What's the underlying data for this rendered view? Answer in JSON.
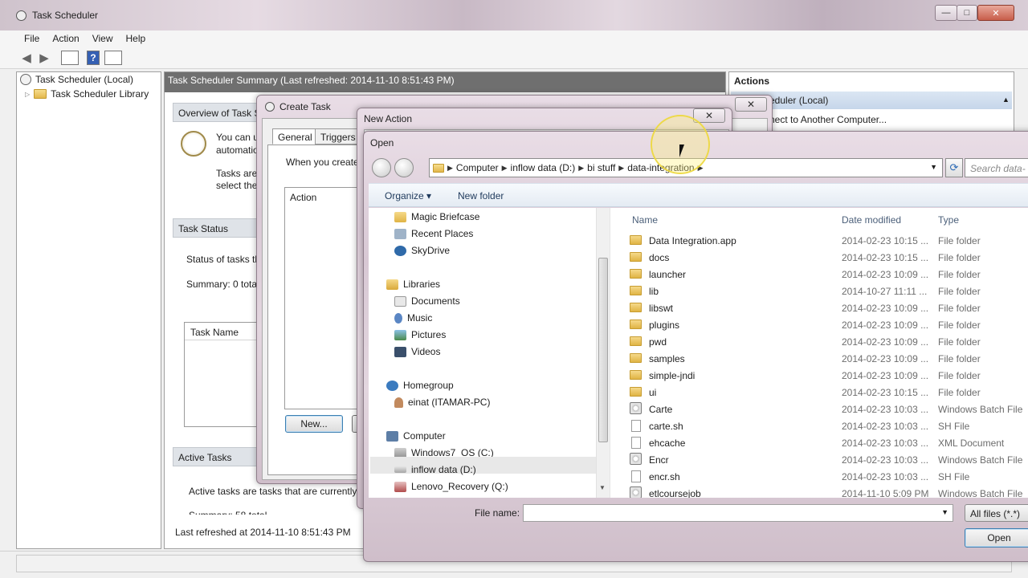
{
  "main": {
    "title": "Task Scheduler",
    "window_buttons": [
      "—",
      "□",
      "✕"
    ],
    "menu": [
      "File",
      "Action",
      "View",
      "Help"
    ],
    "tree": [
      "Task Scheduler (Local)",
      "Task Scheduler Library"
    ],
    "summary_header": "Task Scheduler Summary (Last refreshed: 2014-11-10 8:51:43 PM)",
    "overview_head": "Overview of Task S",
    "overview_text1": "You can u",
    "overview_text2": "automatio",
    "overview_text3": "Tasks are",
    "overview_text4": "select the",
    "status_head": "Task Status",
    "status_text1": "Status of tasks th",
    "status_text2": "Summary: 0 tota",
    "task_name_col": "Task Name",
    "active_head": "Active Tasks",
    "active_text": "Active tasks are tasks that are currently e",
    "active_summary": "Summary: 58 total",
    "last_refreshed": "Last refreshed at 2014-11-10 8:51:43 PM",
    "actions_head": "Actions",
    "actions_sel": "eduler (Local)",
    "actions_item1": "nect to Another Computer..."
  },
  "create_task": {
    "title": "Create Task",
    "tabs": [
      "General",
      "Triggers"
    ],
    "hint": "When you create",
    "action_col": "Action",
    "new_button": "New..."
  },
  "new_action": {
    "title": "New Action",
    "close": "✕"
  },
  "open_dialog": {
    "title": "Open",
    "breadcrumb": [
      "Computer",
      "inflow data (D:)",
      "bi stuff",
      "data-integration"
    ],
    "search_placeholder": "Search data-",
    "organize": "Organize ▾",
    "new_folder": "New folder",
    "nav": {
      "favorites": [
        "Magic Briefcase",
        "Recent Places",
        "SkyDrive"
      ],
      "libraries": "Libraries",
      "library_items": [
        "Documents",
        "Music",
        "Pictures",
        "Videos"
      ],
      "homegroup": "Homegroup",
      "homegroup_user": "einat (ITAMAR-PC)",
      "computer": "Computer",
      "drives": [
        "Windows7_OS (C:)",
        "inflow data (D:)",
        "Lenovo_Recovery (Q:)"
      ]
    },
    "columns": [
      "Name",
      "Date modified",
      "Type"
    ],
    "files": [
      {
        "name": "Data Integration.app",
        "date": "2014-02-23 10:15 ...",
        "type": "File folder",
        "icon": "folder"
      },
      {
        "name": "docs",
        "date": "2014-02-23 10:15 ...",
        "type": "File folder",
        "icon": "folder"
      },
      {
        "name": "launcher",
        "date": "2014-02-23 10:09 ...",
        "type": "File folder",
        "icon": "folder"
      },
      {
        "name": "lib",
        "date": "2014-10-27 11:11 ...",
        "type": "File folder",
        "icon": "folder"
      },
      {
        "name": "libswt",
        "date": "2014-02-23 10:09 ...",
        "type": "File folder",
        "icon": "folder"
      },
      {
        "name": "plugins",
        "date": "2014-02-23 10:09 ...",
        "type": "File folder",
        "icon": "folder"
      },
      {
        "name": "pwd",
        "date": "2014-02-23 10:09 ...",
        "type": "File folder",
        "icon": "folder"
      },
      {
        "name": "samples",
        "date": "2014-02-23 10:09 ...",
        "type": "File folder",
        "icon": "folder"
      },
      {
        "name": "simple-jndi",
        "date": "2014-02-23 10:09 ...",
        "type": "File folder",
        "icon": "folder"
      },
      {
        "name": "ui",
        "date": "2014-02-23 10:15 ...",
        "type": "File folder",
        "icon": "folder"
      },
      {
        "name": "Carte",
        "date": "2014-02-23 10:03 ...",
        "type": "Windows Batch File",
        "icon": "batch"
      },
      {
        "name": "carte.sh",
        "date": "2014-02-23 10:03 ...",
        "type": "SH File",
        "icon": "doc"
      },
      {
        "name": "ehcache",
        "date": "2014-02-23 10:03 ...",
        "type": "XML Document",
        "icon": "doc"
      },
      {
        "name": "Encr",
        "date": "2014-02-23 10:03 ...",
        "type": "Windows Batch File",
        "icon": "batch"
      },
      {
        "name": "encr.sh",
        "date": "2014-02-23 10:03 ...",
        "type": "SH File",
        "icon": "doc"
      },
      {
        "name": "etlcoursejob",
        "date": "2014-11-10 5:09 PM",
        "type": "Windows Batch File",
        "icon": "batch"
      }
    ],
    "file_name_label": "File name:",
    "file_name_value": "",
    "filter": "All files (*.*)",
    "open_button": "Open"
  }
}
